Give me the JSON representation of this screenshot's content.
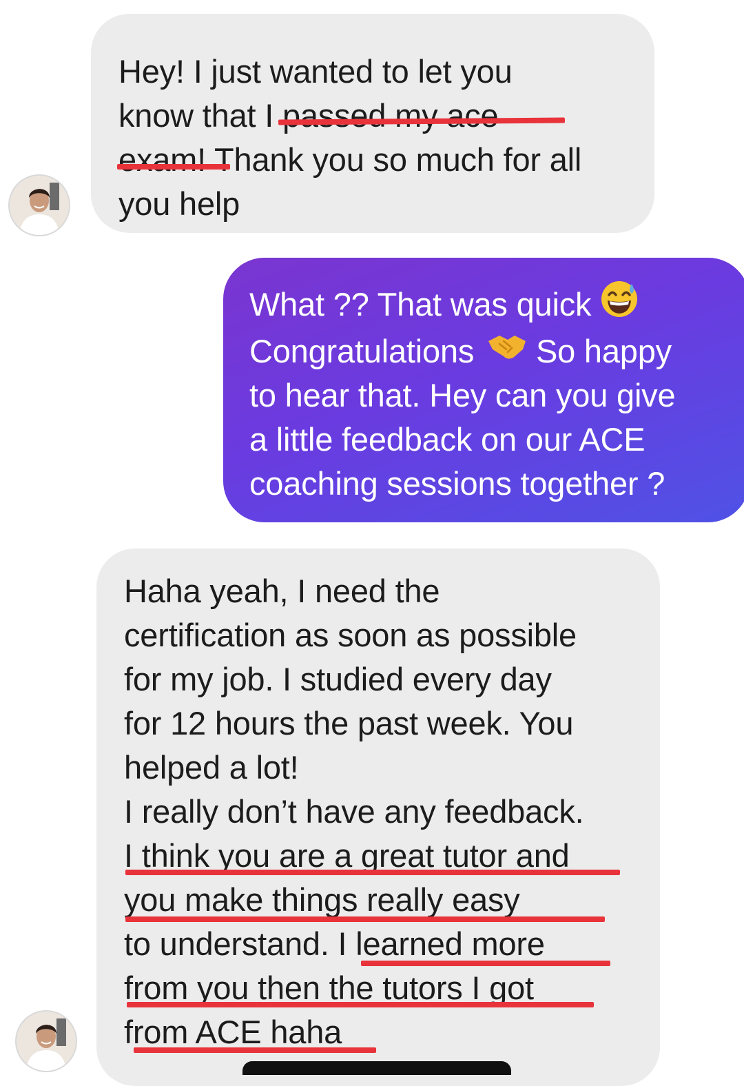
{
  "conversation": {
    "messages": [
      {
        "sender": "contact",
        "lines": [
          "Hey! I just wanted to let you",
          "know that I passed my ace",
          "exam! Thank you so much for all",
          "you help"
        ]
      },
      {
        "sender": "me",
        "lines": [
          "What ?? That was quick",
          "Congratulations",
          "So happy",
          "to hear that. Hey can you give",
          "a little feedback on our ACE",
          "coaching sessions together ?"
        ],
        "emoji": [
          "grinning-sweat-emoji",
          "handshake-emoji"
        ]
      },
      {
        "sender": "contact",
        "lines": [
          "Haha yeah, I need the",
          "certification as soon as possible",
          "for my job. I studied every day",
          "for 12 hours the past week. You",
          "helped a lot!",
          "I really don’t have any feedback.",
          "I think you are a great tutor and",
          "you make things really easy",
          "to understand.  I learned more",
          "from you then the tutors I got",
          "from ACE haha"
        ]
      }
    ]
  },
  "colors": {
    "incoming_bubble": "#ececec",
    "outgoing_gradient_start": "#7a35d0",
    "outgoing_gradient_end": "#4f52e6",
    "highlight_underline": "#e8333b"
  }
}
